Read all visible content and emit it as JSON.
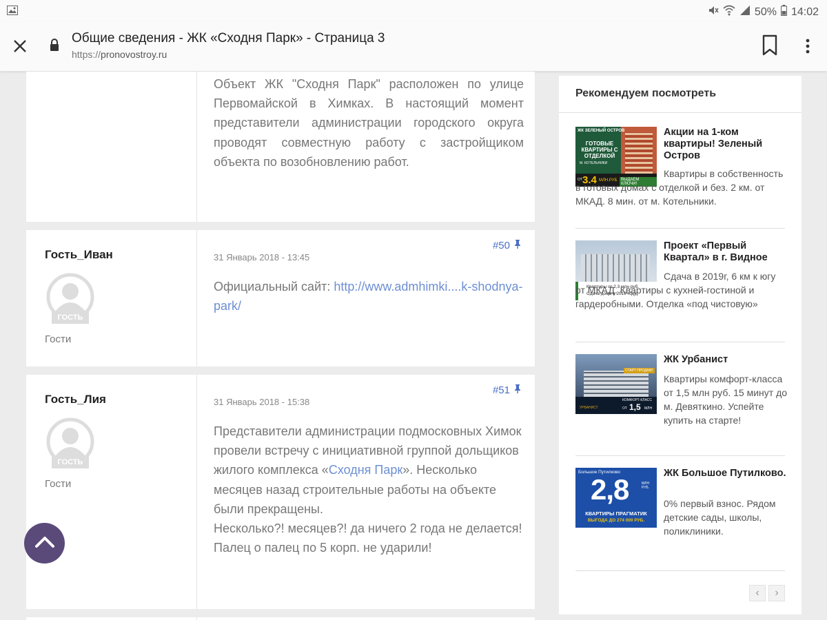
{
  "status": {
    "battery": "50%",
    "time": "14:02"
  },
  "browser": {
    "title": "Общие сведения - ЖК «Сходня Парк» - Страница 3",
    "url_scheme": "https://",
    "url_host": "pronovostroy.ru"
  },
  "posts": {
    "top": {
      "body": "Объект ЖК \"Сходня Парк\" расположен по улице Первомайской в Химках. В настоящий момент представители администрации городского округа проводят совместную работу с застройщиком объекта по возобновлению работ."
    },
    "p50": {
      "author": "Гость_Иван",
      "avatar_label": "ГОСТЬ",
      "group": "Гости",
      "date": "31 Январь 2018 - 13:45",
      "number": "#50",
      "body_prefix": "Официальный сайт: ",
      "link": "http://www.admhimki....k-shodnya-park/"
    },
    "p51": {
      "author": "Гость_Лия",
      "avatar_label": "ГОСТЬ",
      "group": "Гости",
      "date": "31 Январь 2018 - 15:38",
      "number": "#51",
      "body_part1": "Представители администрации подмосковных Химок провели встречу с инициативной группой дольщиков жилого комплекса «",
      "body_link": "Сходня Парк",
      "body_part2": "». Несколько месяцев назад строительные работы на объекте были прекращены.",
      "body_line2": "Несколько?! месяцев?! да ничего 2 года не делается! Палец о палец по 5 корп. не ударили!"
    }
  },
  "sidebar": {
    "title": "Рекомендуем посмотреть",
    "items": [
      {
        "title": "Акции на 1-ком квартиры! Зеленый Остров",
        "text": "Квартиры в собственность в готовых домах с отделкой и без. 2 км. от МКАД. 8 мин. от м. Котельники.",
        "ad_top": "ЖК ЗЕЛЕНЫЙ ОСТРОВ",
        "ad_main": "ГОТОВЫЕ КВАРТИРЫ С ОТДЕЛКОЙ",
        "ad_metro": "М. КОТЕЛЬНИКИ",
        "ad_price_from": "ОТ",
        "ad_price": "3.4",
        "ad_price_unit": "МЛН.РУБ",
        "ad_keys": "ВЫДАЕМ КЛЮЧИ!"
      },
      {
        "title": "Проект «Первый Квартал» в г. Видное",
        "text": "Сдача в 2019г, 6 км к югу от МКАД. Квартиры с кухней-гостиной и гардеробными. Отделка «под чистовую»",
        "ad_line1": "Квартиры от 2,3 млн руб.",
        "ad_line2": "Сдача дома в 2019 году"
      },
      {
        "title": "ЖК Урбанист",
        "text": "Квартиры комфорт-класса от 1,5 млн руб. 15 минут до м. Девяткино. Успейте купить на старте!",
        "ad_badge": "СТАРТ ПРОДАЖ!",
        "ad_brand": "УРБАНИСТ",
        "ad_class": "КОМФОРТ-КЛАСС",
        "ad_from": "ОТ",
        "ad_price": "1,5",
        "ad_unit": "МЛН"
      },
      {
        "title": "ЖК Большое Путилково.",
        "text": "0% первый взнос. Рядом детские сады, школы, поликлиники.",
        "ad_top": "Большое Путилково",
        "ad_big": "2,8",
        "ad_big_unit": "МЛН РУБ.",
        "ad_line1": "КВАРТИРЫ ПРАГМАТИК",
        "ad_line2": "ВЫГОДА ДО 274 000 РУБ."
      }
    ],
    "pager_prev": "‹",
    "pager_next": "›"
  }
}
